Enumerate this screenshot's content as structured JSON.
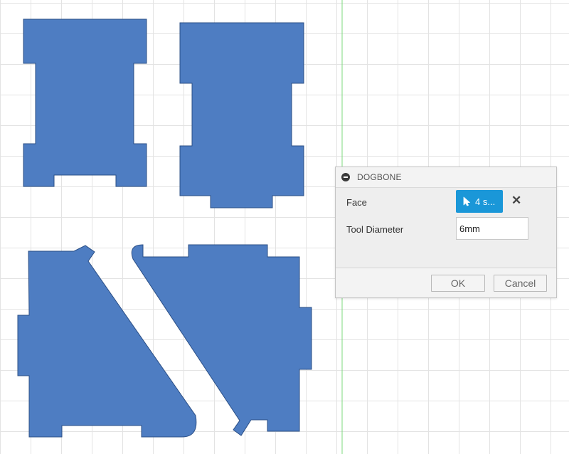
{
  "canvas": {
    "background_color": "#ffffff",
    "grid_color": "#e3e3e3",
    "axis_color": "#7ed87e",
    "part_fill_color": "#4e7dc2",
    "part_edge_color": "#2b4f86",
    "parts": [
      "side-panel-top-left",
      "side-panel-top-right",
      "triangle-panel-left",
      "octagon-panel-right"
    ]
  },
  "dialog": {
    "title": "DOGBONE",
    "collapse_icon": "minus-circle-icon",
    "face": {
      "label": "Face",
      "selection_text": "4 s...",
      "selection_icon": "cursor-arrow-icon",
      "accent_color": "#1a97d8",
      "clear_icon": "close-icon",
      "clear_symbol": "✕"
    },
    "tool_diameter": {
      "label": "Tool Diameter",
      "value": "6mm"
    },
    "ok_label": "OK",
    "cancel_label": "Cancel"
  }
}
